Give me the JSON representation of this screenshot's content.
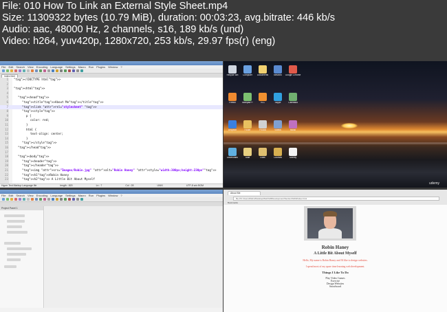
{
  "header": {
    "line1": "File: 010 How To Link an External Style Sheet.mp4",
    "line2": "Size: 11309322 bytes (10.79 MiB), duration: 00:03:23, avg.bitrate: 446 kb/s",
    "line3": "Audio: aac, 48000 Hz, 2 channels, s16, 189 kb/s (und)",
    "line4": "Video: h264, yuv420p, 1280x720, 253 kb/s, 29.97 fps(r) (eng)"
  },
  "editor": {
    "tab": "index.html",
    "menu": [
      "File",
      "Edit",
      "Search",
      "View",
      "Encoding",
      "Language",
      "Settings",
      "Macro",
      "Run",
      "Plugins",
      "Window",
      "?"
    ],
    "lines": [
      {
        "n": "1",
        "text": "<!DOCTYPE html>"
      },
      {
        "n": "2",
        "text": ""
      },
      {
        "n": "3",
        "text": "<html>"
      },
      {
        "n": "4",
        "text": ""
      },
      {
        "n": "5",
        "text": "<head>"
      },
      {
        "n": "6",
        "text": "<title>About Me</title>"
      },
      {
        "n": "7",
        "text": "<link rel=\"stylesheet\" >"
      },
      {
        "n": "8",
        "text": "<style>"
      },
      {
        "n": "9",
        "text": "p {"
      },
      {
        "n": "10",
        "text": "color: red;"
      },
      {
        "n": "11",
        "text": "}"
      },
      {
        "n": "12",
        "text": "html {"
      },
      {
        "n": "13",
        "text": "text-align: center;"
      },
      {
        "n": "14",
        "text": "}"
      },
      {
        "n": "15",
        "text": "</style>"
      },
      {
        "n": "16",
        "text": "</head>"
      },
      {
        "n": "17",
        "text": ""
      },
      {
        "n": "18",
        "text": "<body>"
      },
      {
        "n": "19",
        "text": "<header>"
      },
      {
        "n": "20",
        "text": "</header>"
      },
      {
        "n": "21",
        "text": "<img src=\"Images/Robin.jpg\" alt=\"Robin Haney\" style=\"width:300px;height:230px\">"
      },
      {
        "n": "22",
        "text": "<h1>Robin Haney"
      },
      {
        "n": "23",
        "text": "<h2> A Little Bit About Myself"
      }
    ],
    "status": [
      "Hyper Text Markup Language file",
      "length : 820",
      "Ln : 7",
      "Col : 28",
      "UNIX",
      "UTF-8 w/o BOM",
      "INS"
    ]
  },
  "desktop": {
    "icons": [
      "Recycle Bin",
      "Computer",
      "Documents",
      "Network",
      "Google Chrome",
      "Firefox",
      "Notepad++",
      "VLC",
      "Skype",
      "Camtasia",
      "Dropbox",
      "Folder",
      "Photos",
      "Videos",
      "Music",
      "Downloads",
      "Stuff",
      "Edits",
      "Courses",
      "Udemy"
    ],
    "watermark": "udemy"
  },
  "panel": {
    "header": "Project Panel 1"
  },
  "browser": {
    "tab": "About Me",
    "url": "file:///C:/Users/Robin/Desktop/Web%20Development/Section%203/index.html",
    "bookmarks": "Bookmarks",
    "page": {
      "name": "Robin Haney",
      "subtitle": "A Little Bit About Myself",
      "para1": "Hello, My name is Robin Haney and I'd like to design websites.",
      "para2": "I spend most of my spare time learning web development.",
      "list_title": "Things I Like To Do",
      "list": [
        "Play Video Games",
        "Exercise",
        "Design Websites",
        "Snowboard"
      ]
    }
  }
}
